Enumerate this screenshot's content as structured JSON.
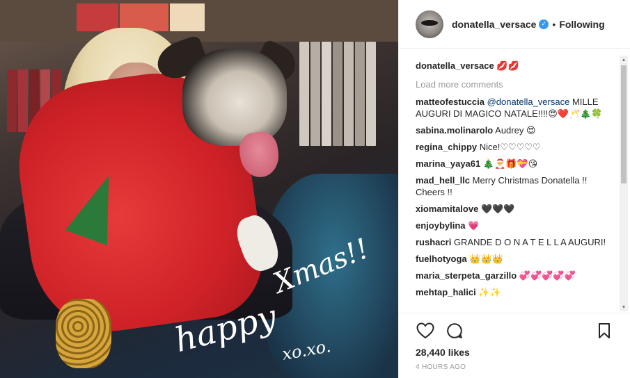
{
  "post": {
    "overlay_text": [
      "happy",
      "Xmas!!",
      "xo.xo."
    ]
  },
  "header": {
    "username": "donatella_versace",
    "separator": "•",
    "follow_status": "Following"
  },
  "caption": {
    "username": "donatella_versace",
    "text": "💋💋"
  },
  "load_more": "Load more comments",
  "comments": [
    {
      "user": "matteofestuccia",
      "mention": "@donatella_versace",
      "text": " MILLE AUGURI DI MAGICO NATALE!!!!😍❤️🥂🎄🍀"
    },
    {
      "user": "sabina.molinarolo",
      "mention": "",
      "text": " Audrey 😍"
    },
    {
      "user": "regina_chippy",
      "mention": "",
      "text": " Nice!♡♡♡♡♡"
    },
    {
      "user": "marina_yaya61",
      "mention": "",
      "text": " 🎄🎅🎁💝😘"
    },
    {
      "user": "mad_hell_llc",
      "mention": "",
      "text": " Merry Christmas Donatella !! Cheers !!"
    },
    {
      "user": "xiomamitalove",
      "mention": "",
      "text": " 🖤🖤🖤"
    },
    {
      "user": "enjoybylina",
      "mention": "",
      "text": " 💗"
    },
    {
      "user": "rushacri",
      "mention": "",
      "text": " GRANDE D O N A T E L L A AUGURI!"
    },
    {
      "user": "fuelhotyoga",
      "mention": "",
      "text": " 👑👑👑"
    },
    {
      "user": "maria_sterpeta_garzillo",
      "mention": "",
      "text": " 💞💞💞💞💞"
    },
    {
      "user": "mehtap_halici",
      "mention": "",
      "text": " ✨✨"
    }
  ],
  "likes": "28,440 likes",
  "time": "4 HOURS AGO",
  "icons": {
    "like": "heart-icon",
    "comment": "comment-icon",
    "save": "bookmark-icon",
    "verified": "verified-badge-icon"
  }
}
